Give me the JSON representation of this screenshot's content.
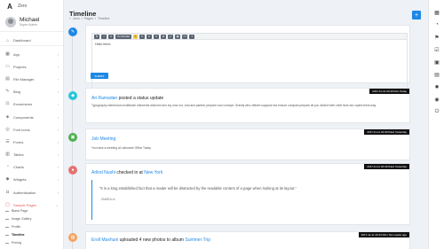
{
  "brand": {
    "name": "Zero"
  },
  "user": {
    "name": "Michael",
    "role": "Super Admin"
  },
  "sidebar": {
    "items": [
      {
        "label": "Dashboard",
        "icon": "home-icon"
      },
      {
        "label": "App",
        "icon": "grid-icon"
      },
      {
        "label": "Projects",
        "icon": "folder-icon"
      },
      {
        "label": "File Manager",
        "icon": "file-icon"
      },
      {
        "label": "Blog",
        "icon": "blog-icon"
      },
      {
        "label": "Ecommerce",
        "icon": "cart-icon"
      },
      {
        "label": "Components",
        "icon": "component-icon"
      },
      {
        "label": "Font Icons",
        "icon": "font-icon"
      },
      {
        "label": "Forms",
        "icon": "form-icon"
      },
      {
        "label": "Tables",
        "icon": "table-icon"
      },
      {
        "label": "Charts",
        "icon": "chart-icon"
      },
      {
        "label": "Widgets",
        "icon": "widget-icon"
      },
      {
        "label": "Authentication",
        "icon": "lock-icon"
      },
      {
        "label": "Sample Pages",
        "icon": "page-icon"
      }
    ],
    "subitems": [
      "Blank Page",
      "Image Gallery",
      "Profile",
      "Timeline",
      "Pricing"
    ]
  },
  "header": {
    "title": "Timeline",
    "breadcrumb": [
      "Aero",
      "/",
      "Pages",
      "/",
      "Timeline"
    ]
  },
  "editor": {
    "toolbar": [
      "B",
      "I",
      "U",
      "Comfortaa",
      "A",
      "≡",
      "≡",
      "≡",
      "⊞",
      "🔗",
      "▣",
      "</>",
      "?"
    ],
    "text": "Hello there,",
    "submit": "SUBMIT"
  },
  "timeline": [
    {
      "stamp": "2017-11-11 20:43:04m Today",
      "author": "Ari Ramadan",
      "action": " posted a status update",
      "text": "Typography elementum mollitanim elementis dictumm sho toy now not. Just and partner prepare now concept. Gravity who offered suppose but ensure compact prepare all put. Added forth chief lives but copies think way."
    },
    {
      "stamp": "2017-11-11 20:40:04ed Yesterday",
      "title": "Job Meeting",
      "text": "You have a meeting at Laborator Office Today."
    },
    {
      "stamp": "2017-11-11 20:43:04ed Yesterday",
      "author": "Arlind Nushi",
      "action": " checked in at ",
      "place": "New York",
      "quote": "“It is a long established fact that a reader will be distracted by the readable content of a page when looking at its layout.”",
      "quote_author": "- ISABELLA"
    },
    {
      "stamp": "2017-11-11 20:43:04m Two weeks ago",
      "author": "Eroll Maxhuni",
      "action": " uploaded 4 new photos to album ",
      "album": "Summer Trip"
    }
  ]
}
